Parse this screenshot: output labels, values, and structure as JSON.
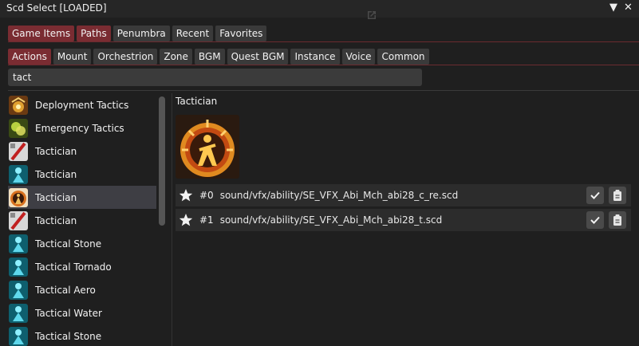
{
  "window": {
    "title": "Scd Select [LOADED]"
  },
  "source_tabs": [
    {
      "label": "Game Items",
      "active": true
    },
    {
      "label": "Paths",
      "active": true
    },
    {
      "label": "Penumbra",
      "active": false
    },
    {
      "label": "Recent",
      "active": false
    },
    {
      "label": "Favorites",
      "active": false
    }
  ],
  "category_tabs": [
    {
      "label": "Actions",
      "active": true
    },
    {
      "label": "Mount",
      "active": false
    },
    {
      "label": "Orchestrion",
      "active": false
    },
    {
      "label": "Zone",
      "active": false
    },
    {
      "label": "BGM",
      "active": false
    },
    {
      "label": "Quest BGM",
      "active": false
    },
    {
      "label": "Instance",
      "active": false
    },
    {
      "label": "Voice",
      "active": false
    },
    {
      "label": "Common",
      "active": false
    }
  ],
  "search": {
    "value": "tact"
  },
  "results": [
    {
      "label": "Deployment Tactics",
      "icon": "deployment-tactics-icon"
    },
    {
      "label": "Emergency Tactics",
      "icon": "emergency-tactics-icon"
    },
    {
      "label": "Tactician",
      "icon": "tactician-red-icon"
    },
    {
      "label": "Tactician",
      "icon": "tactician-cyan-icon"
    },
    {
      "label": "Tactician",
      "icon": "tactician-gold-icon",
      "selected": true
    },
    {
      "label": "Tactician",
      "icon": "tactician-red-icon"
    },
    {
      "label": "Tactical Stone",
      "icon": "tactical-cyan-icon"
    },
    {
      "label": "Tactical Tornado",
      "icon": "tactical-cyan-icon"
    },
    {
      "label": "Tactical Aero",
      "icon": "tactical-cyan-icon"
    },
    {
      "label": "Tactical Water",
      "icon": "tactical-cyan-icon"
    },
    {
      "label": "Tactical Stone",
      "icon": "tactical-cyan-icon"
    }
  ],
  "detail": {
    "title": "Tactician",
    "icon": "tactician-gold-icon",
    "paths": [
      {
        "index": "#0",
        "path": "sound/vfx/ability/SE_VFX_Abi_Mch_abi28_c_re.scd"
      },
      {
        "index": "#1",
        "path": "sound/vfx/ability/SE_VFX_Abi_Mch_abi28_t.scd"
      }
    ]
  },
  "colors": {
    "active_tab": "#7a2c32",
    "tab": "#3a3a3a",
    "selection_marker": "#5a6bd8",
    "panel": "#1f1f1f"
  }
}
